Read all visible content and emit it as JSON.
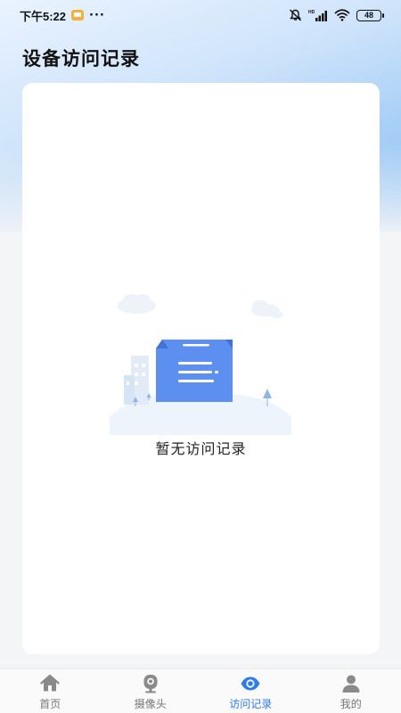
{
  "status_bar": {
    "time": "下午5:22",
    "dots": "···",
    "battery": "48"
  },
  "page": {
    "title": "设备访问记录"
  },
  "empty_state": {
    "message": "暂无访问记录"
  },
  "tab_bar": {
    "active": "tab-access-records",
    "items": [
      {
        "label": "首页",
        "icon": "home-icon"
      },
      {
        "label": "摄像头",
        "icon": "camera-icon"
      },
      {
        "label": "访问记录",
        "icon": "eye-icon"
      },
      {
        "label": "我的",
        "icon": "user-icon"
      }
    ]
  },
  "colors": {
    "accent": "#2f7be8",
    "inactive": "#777777",
    "card": "#ffffff",
    "background": "#f4f5f7"
  }
}
